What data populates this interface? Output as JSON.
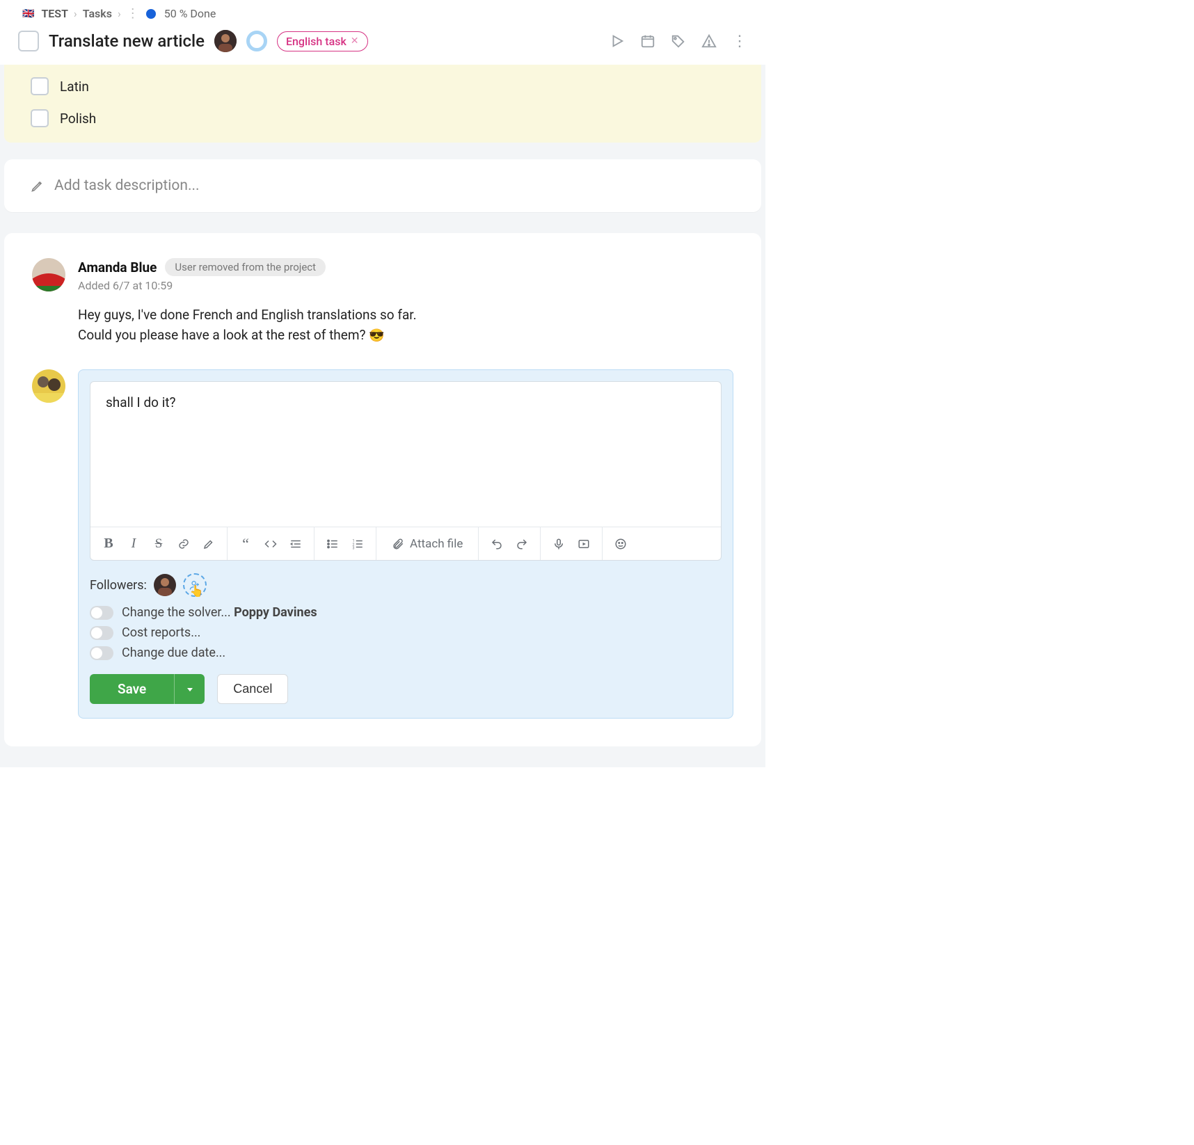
{
  "breadcrumb": {
    "flag": "🇬🇧",
    "root": "TEST",
    "section": "Tasks",
    "status_text": "50 % Done"
  },
  "header": {
    "title": "Translate new article",
    "tag_label": "English task"
  },
  "checklist": {
    "items": [
      {
        "label": "Latin"
      },
      {
        "label": "Polish"
      }
    ]
  },
  "description": {
    "placeholder": "Add task description..."
  },
  "comment": {
    "author": "Amanda Blue",
    "removed_badge": "User removed from the project",
    "meta": "Added 6/7 at 10:59",
    "body_line1": "Hey guys, I've done French and English translations so far.",
    "body_line2": "Could you please have a look at the rest of them? "
  },
  "composer": {
    "text": "shall I do it?",
    "attach_label": "Attach file",
    "followers_label": "Followers:",
    "toggles": {
      "solver_prefix": "Change the solver... ",
      "solver_name": "Poppy Davines",
      "cost": "Cost reports...",
      "due": "Change due date..."
    },
    "save_label": "Save",
    "cancel_label": "Cancel"
  }
}
